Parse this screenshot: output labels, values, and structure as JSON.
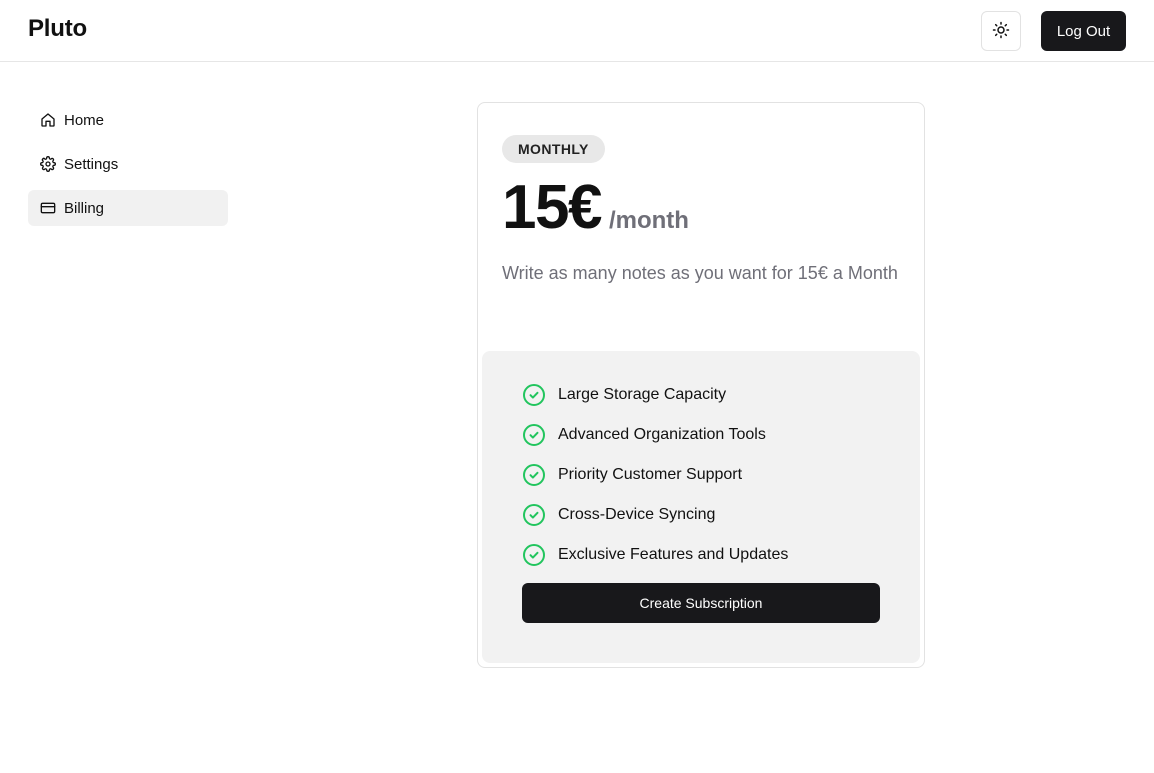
{
  "header": {
    "logo": "Pluto",
    "theme_toggle_icon": "sun-icon",
    "logout_label": "Log Out"
  },
  "sidebar": {
    "items": [
      {
        "label": "Home",
        "icon": "home-icon",
        "active": false
      },
      {
        "label": "Settings",
        "icon": "gear-icon",
        "active": false
      },
      {
        "label": "Billing",
        "icon": "credit-card-icon",
        "active": true
      }
    ]
  },
  "plan": {
    "badge": "MONTHLY",
    "price": "15€",
    "period": "/month",
    "description": "Write as many notes as you want for 15€ a Month",
    "features": [
      "Large Storage Capacity",
      "Advanced Organization Tools",
      "Priority Customer Support",
      "Cross-Device Syncing",
      "Exclusive Features and Updates"
    ],
    "cta_label": "Create Subscription"
  },
  "colors": {
    "primary_button": "#18181b",
    "check_green": "#22c55e",
    "active_nav_bg": "#f1f1f1",
    "features_bg": "#f2f2f2"
  }
}
